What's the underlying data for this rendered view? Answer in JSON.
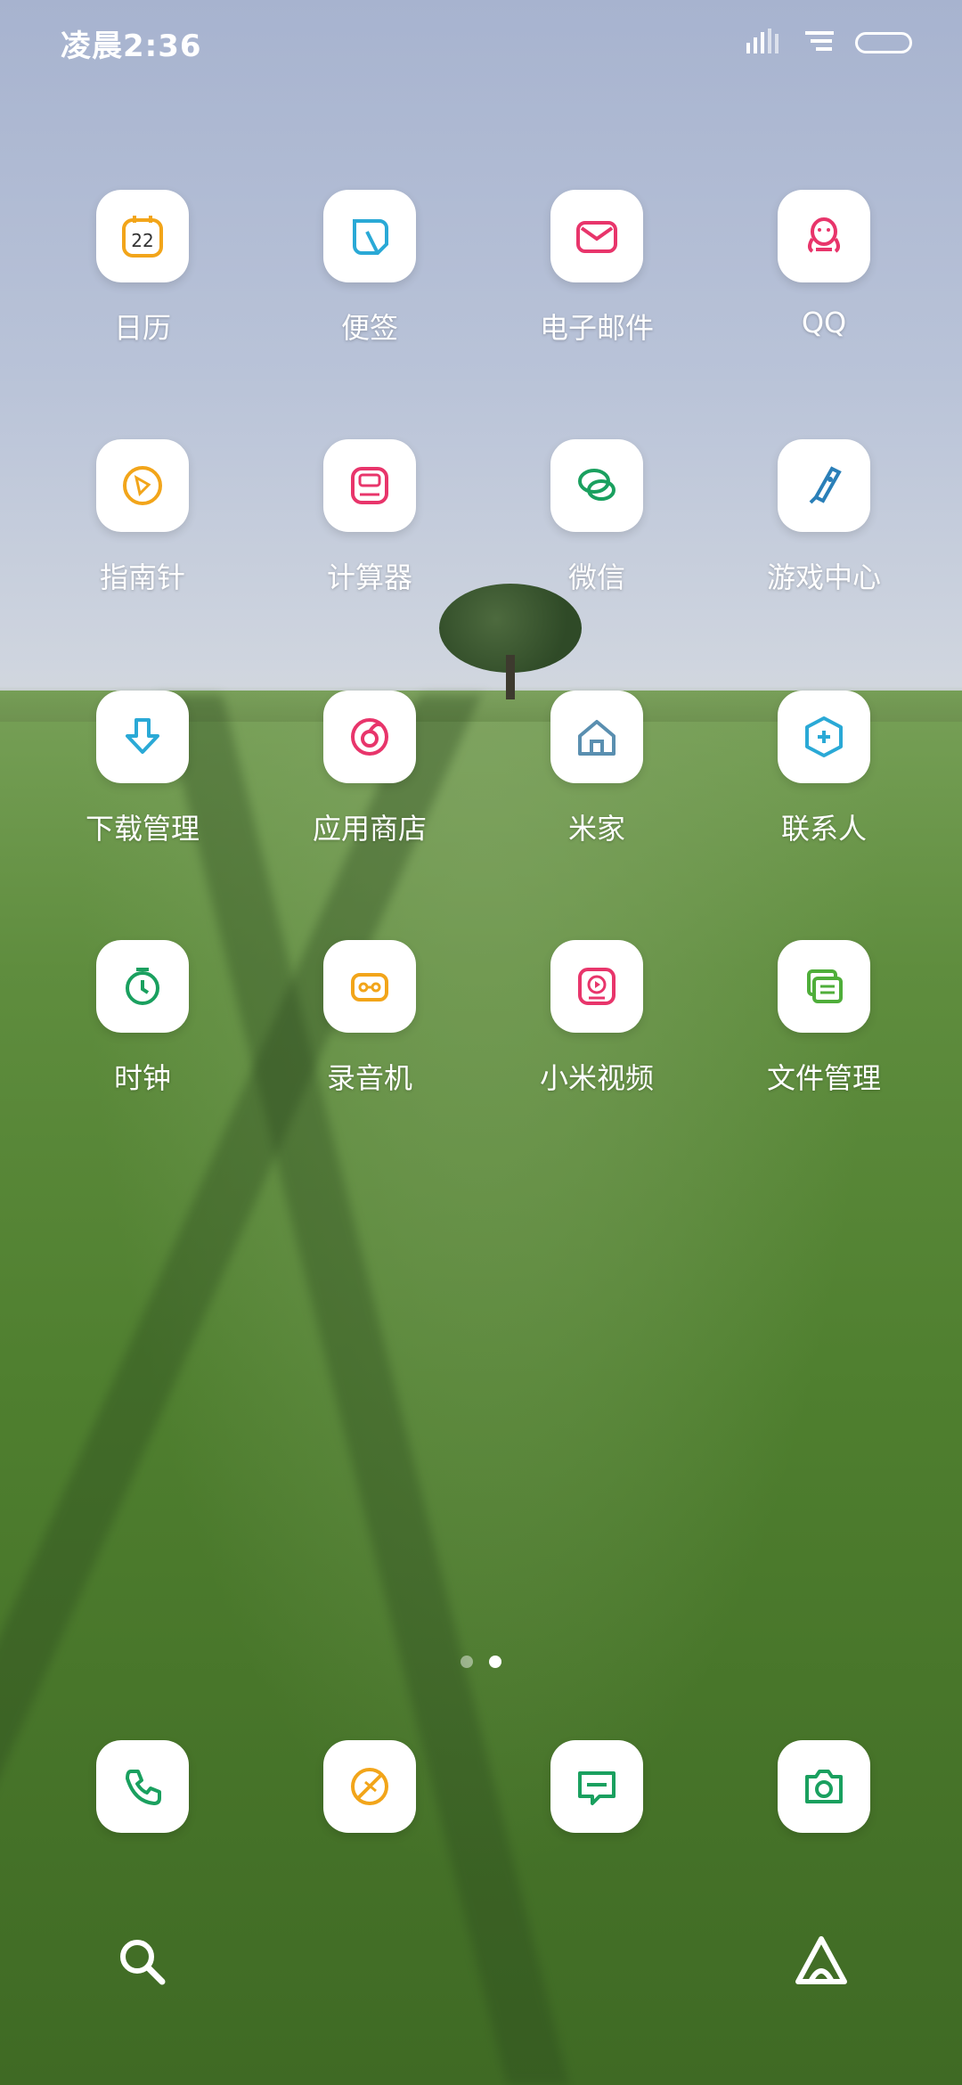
{
  "status_bar": {
    "time": "凌晨2:36",
    "icons": [
      "signal-icon",
      "wifi-icon",
      "battery-icon"
    ]
  },
  "apps": [
    {
      "label": "日历",
      "icon": "calendar-icon",
      "badge": "22",
      "color": "#f2a51a"
    },
    {
      "label": "便签",
      "icon": "notes-icon",
      "color": "#2aa9d6"
    },
    {
      "label": "电子邮件",
      "icon": "email-icon",
      "color": "#e8356b"
    },
    {
      "label": "QQ",
      "icon": "qq-icon",
      "color": "#e8356b"
    },
    {
      "label": "指南针",
      "icon": "compass-icon",
      "color": "#f2a51a"
    },
    {
      "label": "计算器",
      "icon": "calculator-icon",
      "color": "#e8356b"
    },
    {
      "label": "微信",
      "icon": "wechat-icon",
      "color": "#1aa05f"
    },
    {
      "label": "游戏中心",
      "icon": "game-center-icon",
      "color": "#2a7fb8"
    },
    {
      "label": "下载管理",
      "icon": "download-icon",
      "color": "#2aa9d6"
    },
    {
      "label": "应用商店",
      "icon": "app-store-icon",
      "color": "#e8356b"
    },
    {
      "label": "米家",
      "icon": "mijia-home-icon",
      "color": "#5a8fb0"
    },
    {
      "label": "联系人",
      "icon": "contacts-icon",
      "color": "#2aa9d6"
    },
    {
      "label": "时钟",
      "icon": "clock-icon",
      "color": "#1aa05f"
    },
    {
      "label": "录音机",
      "icon": "recorder-icon",
      "color": "#f2a51a"
    },
    {
      "label": "小米视频",
      "icon": "video-icon",
      "color": "#e8356b"
    },
    {
      "label": "文件管理",
      "icon": "file-manager-icon",
      "color": "#4fae3a"
    }
  ],
  "page_indicator": {
    "pages": 2,
    "active": 2
  },
  "dock": [
    {
      "icon": "phone-icon",
      "color": "#1aa05f"
    },
    {
      "icon": "browser-icon",
      "color": "#f2a51a"
    },
    {
      "icon": "messages-icon",
      "color": "#1aa05f"
    },
    {
      "icon": "camera-icon",
      "color": "#1aa05f"
    }
  ],
  "bottom_bar": {
    "left_icon": "search-icon",
    "right_icon": "assistant-icon"
  }
}
